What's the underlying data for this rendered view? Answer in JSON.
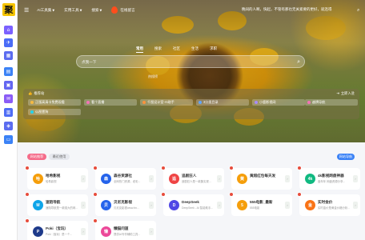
{
  "topbar": {
    "nav": [
      {
        "label": "AI工具集",
        "has_caret": true
      },
      {
        "label": "实用工具",
        "has_caret": true
      },
      {
        "label": "搜索",
        "has_caret": true
      },
      {
        "label": "在线留言",
        "has_caret": false
      }
    ],
    "greeting": "晚间的人啊，快起，不管有那也无关紧要的更好，就连得"
  },
  "sidebar": {
    "logo_text": "聚",
    "icons": [
      {
        "name": "home-icon",
        "color": "#7b61ff"
      },
      {
        "name": "plane-icon",
        "color": "#4a6cf7"
      },
      {
        "name": "grid-icon",
        "color": "#5b6cf0"
      },
      {
        "name": "doc-icon",
        "color": "#3b82f6"
      },
      {
        "name": "apps-icon",
        "color": "#6366f1"
      },
      {
        "name": "chat-icon",
        "color": "#8b5cf6"
      },
      {
        "name": "table-icon",
        "color": "#4f6df5"
      },
      {
        "name": "game-icon",
        "color": "#5b6cf0"
      },
      {
        "name": "card-icon",
        "color": "#3b82f6"
      }
    ]
  },
  "hero": {
    "tabs": [
      "常用",
      "搜索",
      "社区",
      "生活",
      "求职"
    ],
    "active_tab_index": 0,
    "search_placeholder": "点我一下",
    "search_sub": "热搜榜"
  },
  "quick": {
    "header": "推荐站",
    "login": "立即入驻",
    "links": [
      {
        "label": "正版高清卡免费观看",
        "color": "#f5b942"
      },
      {
        "label": "看个直播",
        "color": "#f472b6"
      },
      {
        "label": "千图设计室-AI助手",
        "color": "#fb923c"
      },
      {
        "label": "3分类目录",
        "color": "#60a5fa"
      },
      {
        "label": "小鹿影视网",
        "color": "#a78bfa"
      },
      {
        "label": "越牌导航",
        "color": "#f472b6"
      },
      {
        "label": "仏图壹狗",
        "color": "#22d3ee"
      }
    ]
  },
  "content": {
    "tabs": [
      "网站推荐",
      "最近使用"
    ],
    "more": "网站导航",
    "cards": [
      {
        "title": "哈希影视",
        "desc": "哈希影视",
        "icon": "哈",
        "color": "#f59e0b",
        "hot": true
      },
      {
        "title": "森谷资源社",
        "desc": "全网热门资源，老彩...",
        "icon": "森",
        "color": "#2563eb",
        "hot": true
      },
      {
        "title": "追剧狂人",
        "desc": "追剧狂人是一款集实现...",
        "icon": "追",
        "color": "#ef4444",
        "hot": true
      },
      {
        "title": "黄超红包每天发",
        "desc": "",
        "icon": "黄",
        "color": "#f59e0b",
        "hot": true
      },
      {
        "title": "4k影视网盘神器",
        "desc": "盘年年 网盘资源分享...",
        "icon": "4k",
        "color": "#10b981",
        "hot": true
      },
      {
        "title": "速陌导航",
        "desc": "速陌导航是一款强大的网...",
        "icon": "M",
        "color": "#0ea5e9",
        "hot": true
      },
      {
        "title": "贝尼克影视",
        "desc": "贝尼克影视www.bn...",
        "icon": "贝",
        "color": "#2563eb",
        "hot": true
      },
      {
        "title": "DeepSeek",
        "desc": "DeepSeek - AI 智能助手...",
        "icon": "D",
        "color": "#4f46e5",
        "hot": true
      },
      {
        "title": "555电影_最新",
        "desc": "555电影",
        "icon": "5",
        "color": "#f59e0b",
        "hot": true
      },
      {
        "title": "实时金价",
        "desc": "实时金价是黄金价格分析...",
        "icon": "金",
        "color": "#f97316",
        "hot": true
      },
      {
        "title": "Poki（宝玩）",
        "desc": "Poki（宝玩）是一个...",
        "icon": "P",
        "color": "#1e3a8a",
        "hot": true
      },
      {
        "title": "懒猫问道",
        "desc": "提供AI写作辅助工具...",
        "icon": "懒",
        "color": "#ec4899",
        "hot": true
      }
    ]
  }
}
